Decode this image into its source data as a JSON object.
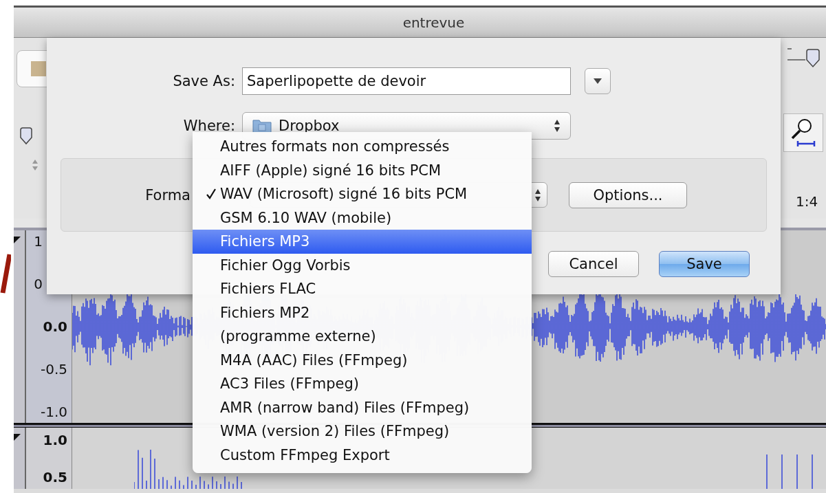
{
  "window": {
    "title": "entrevue"
  },
  "save_dialog": {
    "save_as": {
      "label": "Save As:",
      "value": "Saperlipopette de devoir"
    },
    "where": {
      "label": "Where:",
      "value": "Dropbox"
    },
    "format": {
      "label": "Forma"
    },
    "options_button": {
      "label": "Options..."
    },
    "buttons": [
      {
        "label": "Cancel",
        "kind": "normal"
      },
      {
        "label": "Save",
        "kind": "default"
      }
    ]
  },
  "format_menu": {
    "items": [
      {
        "label": "Autres formats non compressés",
        "checked": false,
        "selected": false
      },
      {
        "label": "AIFF (Apple) signé 16 bits PCM",
        "checked": false,
        "selected": false
      },
      {
        "label": "WAV (Microsoft) signé 16 bits PCM",
        "checked": true,
        "selected": false
      },
      {
        "label": "GSM 6.10 WAV (mobile)",
        "checked": false,
        "selected": false
      },
      {
        "label": "Fichiers MP3",
        "checked": false,
        "selected": true
      },
      {
        "label": "Fichier Ogg Vorbis",
        "checked": false,
        "selected": false
      },
      {
        "label": "Fichiers FLAC",
        "checked": false,
        "selected": false
      },
      {
        "label": "Fichiers MP2",
        "checked": false,
        "selected": false
      },
      {
        "label": "(programme externe)",
        "checked": false,
        "selected": false
      },
      {
        "label": "M4A (AAC) Files (FFmpeg)",
        "checked": false,
        "selected": false
      },
      {
        "label": "AC3 Files (FFmpeg)",
        "checked": false,
        "selected": false
      },
      {
        "label": "AMR (narrow band) Files (FFmpeg)",
        "checked": false,
        "selected": false
      },
      {
        "label": "WMA (version 2) Files (FFmpeg)",
        "checked": false,
        "selected": false
      },
      {
        "label": "Custom FFmpeg Export",
        "checked": false,
        "selected": false
      }
    ]
  },
  "ruler": {
    "label": "1:4"
  },
  "tracks": [
    {
      "axis_labels": [
        "1",
        "0",
        "0.0",
        "-0.5",
        "-1.0"
      ]
    },
    {
      "axis_labels": [
        "1.0",
        "0.5"
      ]
    }
  ]
}
